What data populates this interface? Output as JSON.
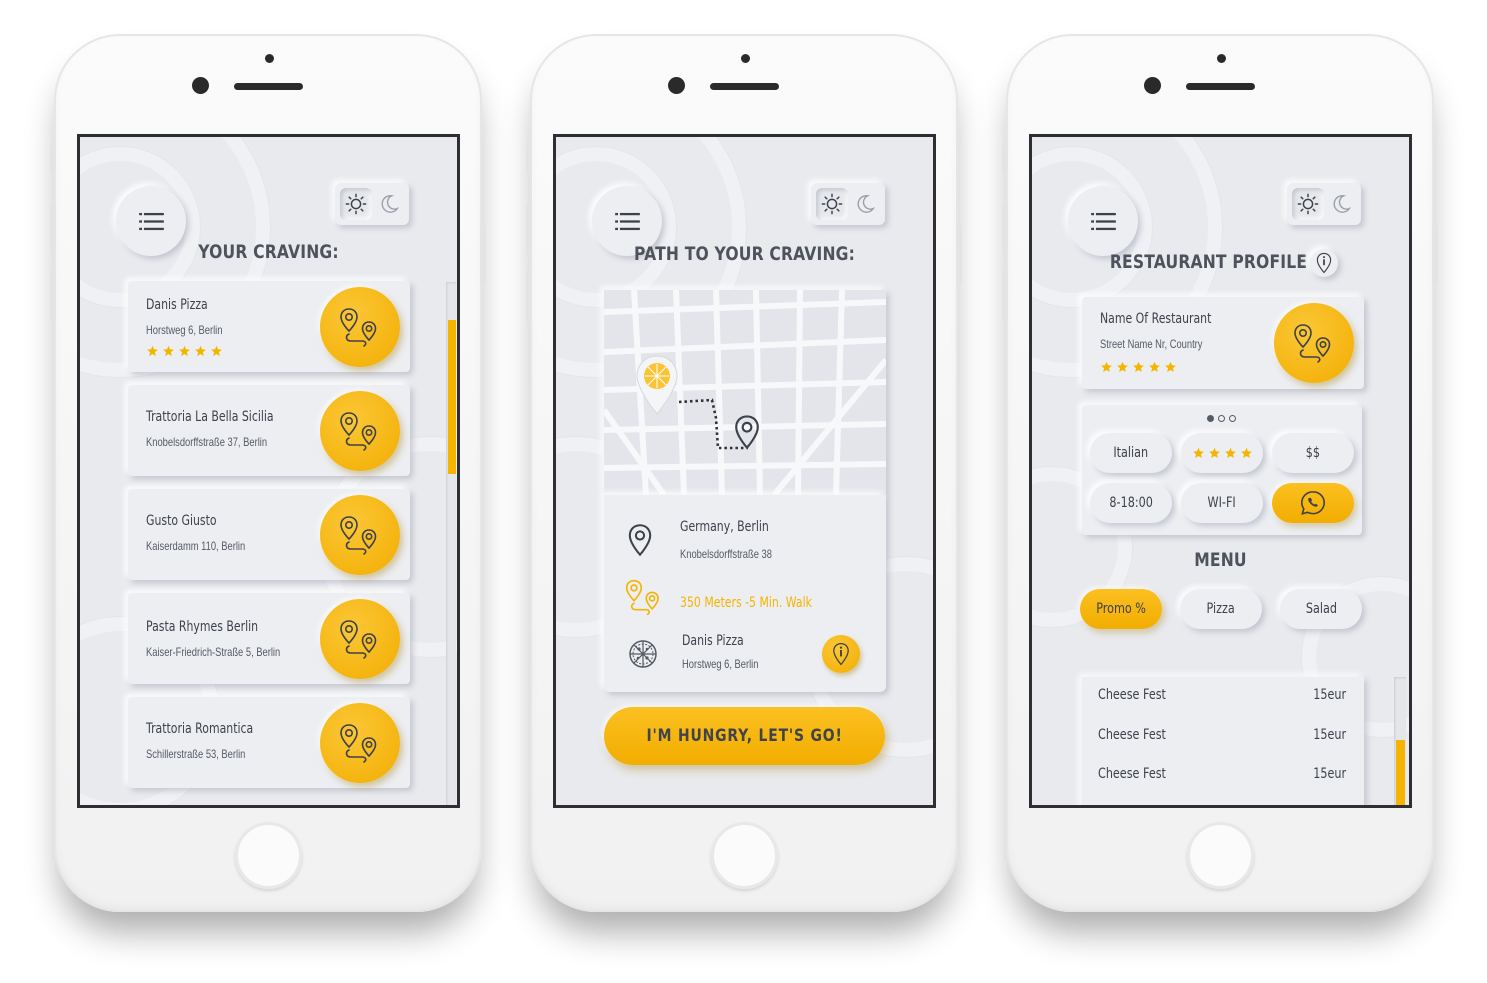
{
  "colors": {
    "accent": "#f5b400",
    "background": "#e9eaee",
    "text": "#3d414a",
    "phone_body": "#f7f7f8"
  },
  "screen1": {
    "title": "YOUR  CRAVING:",
    "restaurants": [
      {
        "name": "Danis Pizza",
        "address": "Horstweg 6, Berlin",
        "rating": 5
      },
      {
        "name": "Trattoria La Bella Sicilia",
        "address": "Knobelsdorffstraße 37, Berlin"
      },
      {
        "name": "Gusto Giusto",
        "address": "Kaiserdamm 110,  Berlin"
      },
      {
        "name": "Pasta Rhymes Berlin",
        "address": "Kaiser-Friedrich-Straße 5, Berlin"
      },
      {
        "name": "Trattoria Romantica",
        "address": "Schillerstraße 53, Berlin"
      }
    ]
  },
  "screen2": {
    "title": "PATH TO YOUR CRAVING:",
    "location_city": "Germany, Berlin",
    "location_street": "Knobelsdorffstraße 38",
    "distance": "350 Meters -5 Min. Walk",
    "dest_name": "Danis Pizza",
    "dest_address": "Horstweg 6, Berlin",
    "cta": "I'M HUNGRY, LET'S GO!"
  },
  "screen3": {
    "title": "RESTAURANT PROFILE",
    "name": "Name Of Restaurant",
    "address": "Street Name Nr, Country",
    "rating": 5,
    "chips": {
      "cuisine": "Italian",
      "stars": 4,
      "price": "$$",
      "hours": "8-18:00",
      "wifi": "WI-FI"
    },
    "menu_title": "MENU",
    "tabs": [
      "Promo %",
      "Pizza",
      "Salad"
    ],
    "menu_items": [
      {
        "name": "Cheese Fest",
        "price": "15eur"
      },
      {
        "name": "Cheese Fest",
        "price": "15eur"
      },
      {
        "name": "Cheese Fest",
        "price": "15eur"
      }
    ]
  },
  "icons": {
    "menu": "hamburger-icon",
    "light": "sun-icon",
    "dark": "moon-icon",
    "route": "route-pins-icon",
    "pin": "location-pin-icon",
    "pizza": "pizza-icon",
    "info": "info-icon",
    "whatsapp": "whatsapp-icon",
    "star": "star-icon"
  }
}
